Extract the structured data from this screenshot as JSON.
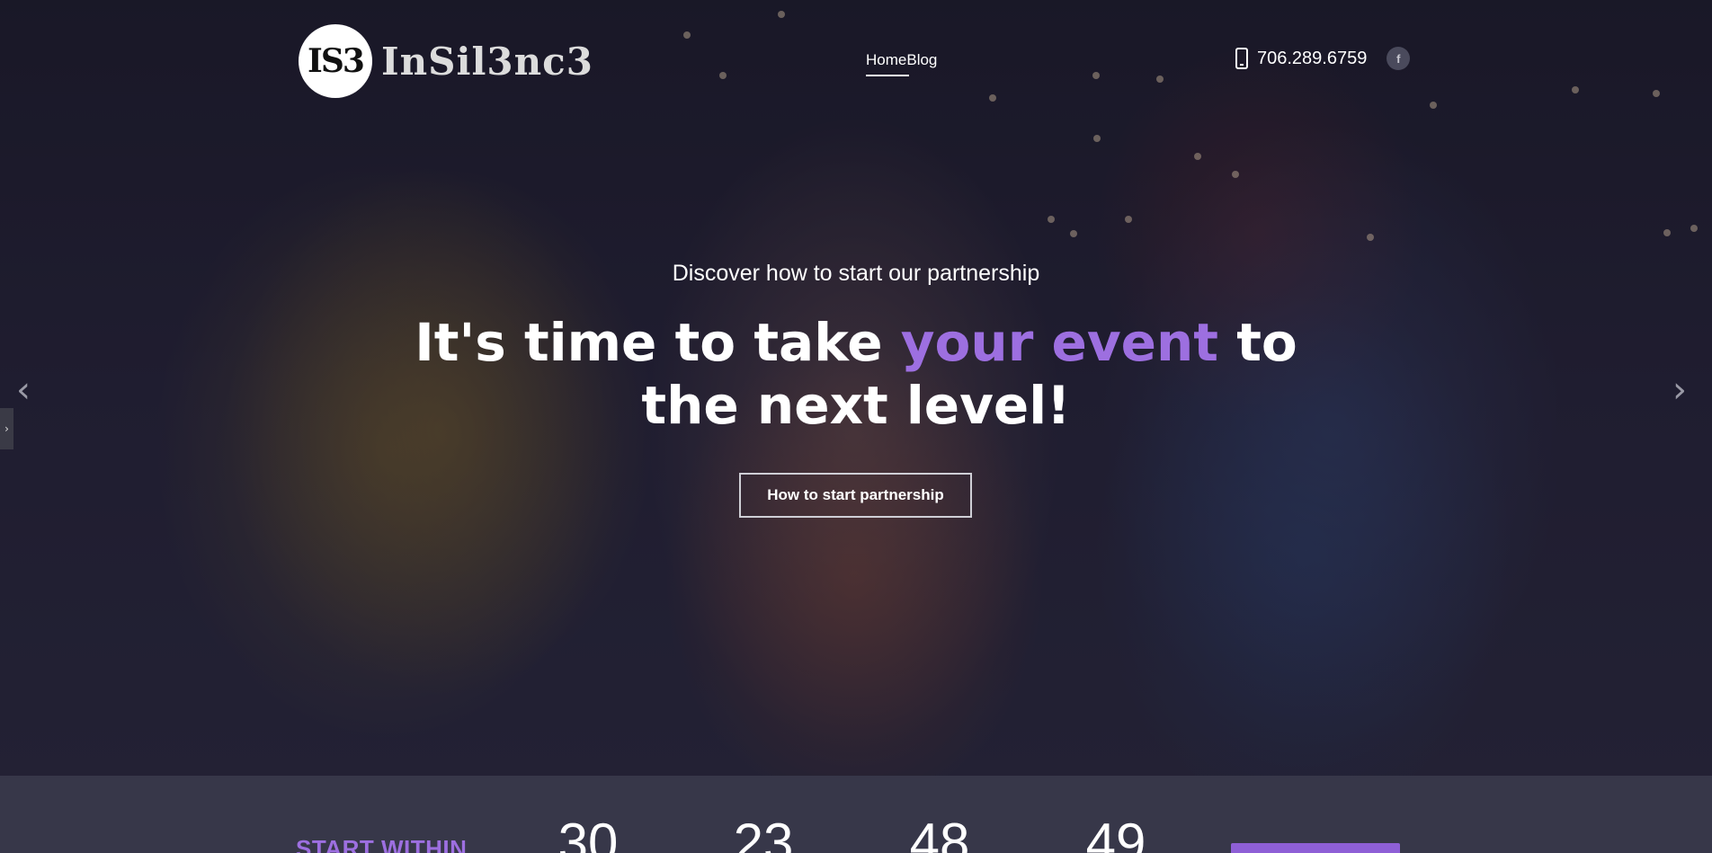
{
  "header": {
    "logo_badge": "IS3",
    "logo_text": "InSil3nc3",
    "nav": [
      {
        "label": "Home",
        "active": true
      },
      {
        "label": "Blog",
        "active": false
      }
    ],
    "phone": "706.289.6759",
    "social_icon": "f"
  },
  "hero": {
    "subtitle": "Discover how to start our partnership",
    "headline_part1": "It's time to take ",
    "headline_accent": "your event",
    "headline_part2": " to the next level!",
    "cta_label": "How to start partnership",
    "prev_arrow": "‹",
    "next_arrow": "›",
    "side_tab_icon": "›"
  },
  "countdown": {
    "label": "START WITHIN",
    "values": [
      "30",
      "23",
      "48",
      "49"
    ]
  },
  "colors": {
    "accent": "#9d6fe0",
    "countdown_bg": "#373749",
    "button": "#8e5fd6"
  }
}
